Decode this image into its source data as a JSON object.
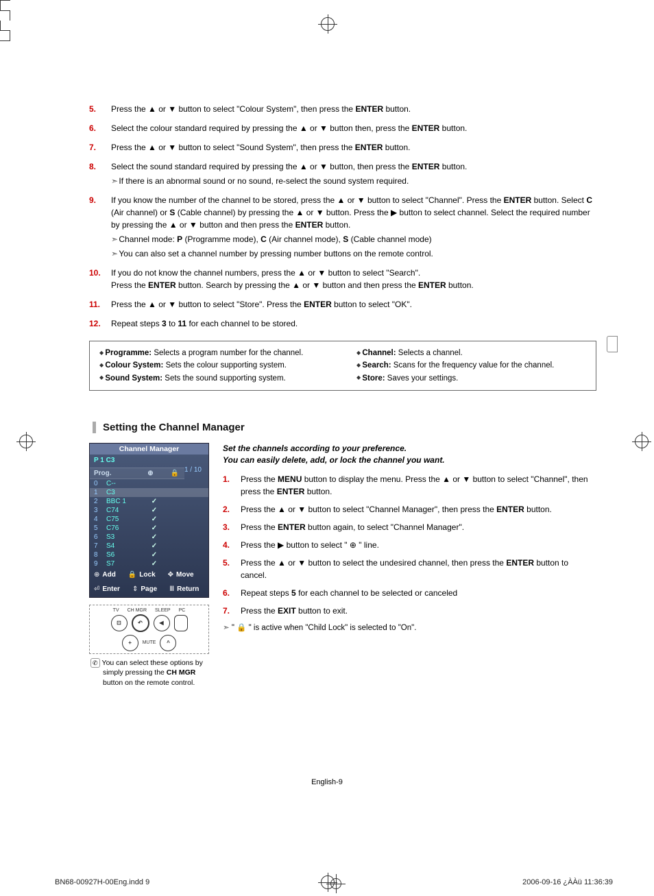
{
  "steps_top": [
    {
      "n": "5.",
      "text": "Press the ▲ or ▼ button to select \"Colour System\", then press the <b>ENTER</b> button."
    },
    {
      "n": "6.",
      "text": "Select the colour standard required by pressing the ▲ or ▼ button then, press the <b>ENTER</b> button."
    },
    {
      "n": "7.",
      "text": "Press the ▲ or ▼ button to select \"Sound System\", then press the <b>ENTER</b> button."
    },
    {
      "n": "8.",
      "text": "Select the sound standard required by pressing the ▲ or ▼ button, then press the <b>ENTER</b> button.",
      "notes": [
        "If there is an abnormal sound or no sound, re-select the sound system required."
      ]
    },
    {
      "n": "9.",
      "text": "If you know the number of the channel to be stored, press the ▲ or ▼ button to select \"Channel\". Press the <b>ENTER</b> button. Select <b>C</b> (Air channel) or <b>S</b> (Cable channel) by pressing the ▲ or ▼ button. Press the ▶ button to select channel. Select the required number by pressing the ▲ or ▼ button and then press the <b>ENTER</b> button.",
      "notes": [
        "Channel mode: <b>P</b> (Programme mode), <b>C</b> (Air channel mode), <b>S</b> (Cable channel mode)",
        "You can also set a channel number by pressing number buttons on the remote control."
      ]
    },
    {
      "n": "10.",
      "text": "If you do not know the channel numbers, press the ▲ or ▼ button to select \"Search\".<br>Press the <b>ENTER</b> button. Search by pressing the ▲ or ▼ button and then press the <b>ENTER</b> button."
    },
    {
      "n": "11.",
      "text": "Press the ▲ or ▼ button to select \"Store\". Press the <b>ENTER</b> button to select \"OK\"."
    },
    {
      "n": "12.",
      "text": "Repeat steps <b>3</b> to <b>11</b> for each channel to be stored."
    }
  ],
  "defs_left": [
    "<b>Programme:</b> Selects a program number for the channel.",
    "<b>Colour System:</b> Sets the colour supporting system.",
    "<b>Sound System:</b> Sets the sound supporting system."
  ],
  "defs_right": [
    "<b>Channel:</b> Selects a channel.",
    "<b>Search:</b> Scans for the frequency value for the channel.",
    "<b>Store:</b> Saves your settings."
  ],
  "section_title": "Setting the Channel Manager",
  "osd": {
    "title": "Channel Manager",
    "sub": "P 1   C3",
    "count": "1 / 10",
    "header": {
      "prog": "Prog.",
      "add": "⊕",
      "lock": "🔒"
    },
    "rows": [
      {
        "n": "0",
        "name": "C--",
        "chk": false,
        "hi": false
      },
      {
        "n": "1",
        "name": "C3",
        "chk": false,
        "hi": true
      },
      {
        "n": "2",
        "name": "BBC 1",
        "chk": true,
        "hi": false
      },
      {
        "n": "3",
        "name": "C74",
        "chk": true,
        "hi": false
      },
      {
        "n": "4",
        "name": "C75",
        "chk": true,
        "hi": false
      },
      {
        "n": "5",
        "name": "C76",
        "chk": true,
        "hi": false
      },
      {
        "n": "6",
        "name": "S3",
        "chk": true,
        "hi": false
      },
      {
        "n": "7",
        "name": "S4",
        "chk": true,
        "hi": false
      },
      {
        "n": "8",
        "name": "S6",
        "chk": true,
        "hi": false
      },
      {
        "n": "9",
        "name": "S7",
        "chk": true,
        "hi": false
      }
    ],
    "legend": {
      "add": "Add",
      "lock": "Lock",
      "move": "Move",
      "enter": "Enter",
      "page": "Page",
      "return": "Return"
    }
  },
  "remote_labels": [
    "TV",
    "CH MGR",
    "SLEEP",
    "PC"
  ],
  "remote_mute": "MUTE",
  "remote_note": "You can select these options  by simply pressing the  <b>CH MGR</b> button on the remote control.",
  "intro1": "Set the channels according to your preference.",
  "intro2": "You can easily delete, add, or lock the channel you want.",
  "steps_right": [
    {
      "n": "1.",
      "text": "Press the <b>MENU</b> button to display the menu.  Press the ▲ or ▼ button to select \"Channel\", then press the <b>ENTER</b> button."
    },
    {
      "n": "2.",
      "text": "Press the ▲ or ▼ button to select \"Channel Manager\", then press the <b>ENTER</b> button."
    },
    {
      "n": "3.",
      "text": "Press the <b>ENTER</b> button again, to select \"Channel Manager\"."
    },
    {
      "n": "4.",
      "text": "Press the ▶ button to select \" ⊕ \" line."
    },
    {
      "n": "5.",
      "text": "Press the ▲ or ▼ button to select the undesired channel, then press the <b>ENTER</b> button to cancel."
    },
    {
      "n": "6.",
      "text": "Repeat steps <b>5</b> for each channel to be selected or canceled"
    },
    {
      "n": "7.",
      "text": "Press the <b>EXIT</b> button to exit."
    }
  ],
  "end_note": "\" 🔒 \" is active when \"Child Lock\" is selected to \"On\".",
  "page_foot": "English-9",
  "print_foot_left": "BN68-00927H-00Eng.indd   9",
  "print_foot_right": "2006-09-16   ¿ÀÀü 11:36:39"
}
